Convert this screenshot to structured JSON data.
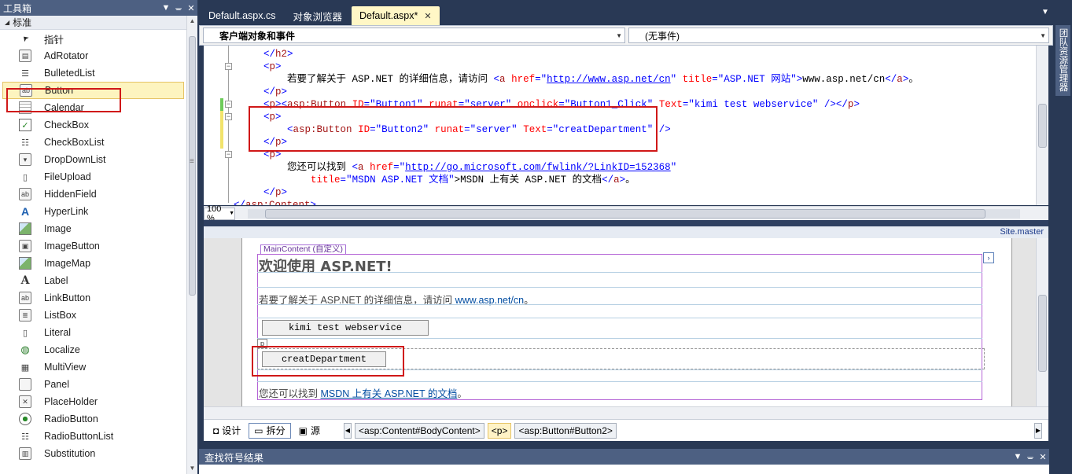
{
  "toolbox": {
    "title": "工具箱",
    "group": "标准",
    "items": [
      {
        "label": "指针",
        "icon": "pointer-icon"
      },
      {
        "label": "AdRotator",
        "icon": "adrotator-icon"
      },
      {
        "label": "BulletedList",
        "icon": "bulleted-list-icon"
      },
      {
        "label": "Button",
        "icon": "button-icon"
      },
      {
        "label": "Calendar",
        "icon": "calendar-icon"
      },
      {
        "label": "CheckBox",
        "icon": "checkbox-icon"
      },
      {
        "label": "CheckBoxList",
        "icon": "checkbox-list-icon"
      },
      {
        "label": "DropDownList",
        "icon": "dropdown-list-icon"
      },
      {
        "label": "FileUpload",
        "icon": "file-upload-icon"
      },
      {
        "label": "HiddenField",
        "icon": "hidden-field-icon"
      },
      {
        "label": "HyperLink",
        "icon": "hyperlink-icon"
      },
      {
        "label": "Image",
        "icon": "image-icon"
      },
      {
        "label": "ImageButton",
        "icon": "image-button-icon"
      },
      {
        "label": "ImageMap",
        "icon": "image-map-icon"
      },
      {
        "label": "Label",
        "icon": "label-icon"
      },
      {
        "label": "LinkButton",
        "icon": "link-button-icon"
      },
      {
        "label": "ListBox",
        "icon": "listbox-icon"
      },
      {
        "label": "Literal",
        "icon": "literal-icon"
      },
      {
        "label": "Localize",
        "icon": "localize-icon"
      },
      {
        "label": "MultiView",
        "icon": "multiview-icon"
      },
      {
        "label": "Panel",
        "icon": "panel-icon"
      },
      {
        "label": "PlaceHolder",
        "icon": "placeholder-icon"
      },
      {
        "label": "RadioButton",
        "icon": "radio-button-icon"
      },
      {
        "label": "RadioButtonList",
        "icon": "radio-button-list-icon"
      },
      {
        "label": "Substitution",
        "icon": "substitution-icon"
      }
    ],
    "selected": "Button"
  },
  "tabs": [
    {
      "label": "Default.aspx.cs",
      "active": false
    },
    {
      "label": "对象浏览器",
      "active": false
    },
    {
      "label": "Default.aspx*",
      "active": true
    }
  ],
  "nav": {
    "left_combo": "客户端对象和事件",
    "right_combo": "(无事件)"
  },
  "code": {
    "lines": [
      "        </h2>",
      "        <p>",
      "            若要了解关于 ASP.NET 的详细信息，请访问 <a href=\"http://www.asp.net/cn\" title=\"ASP.NET 网站\">www.asp.net/cn</a>。",
      "        </p>",
      "        <p><asp:Button ID=\"Button1\" runat=\"server\" onclick=\"Button1_Click\" Text=\"kimi test webservice\" /></p>",
      "        <p>",
      "            <asp:Button ID=\"Button2\" runat=\"server\" Text=\"creatDepartment\" />",
      "        </p>",
      "        <p>",
      "            您还可以找到 <a href=\"http://go.microsoft.com/fwlink/?LinkID=152368\"",
      "                title=\"MSDN ASP.NET 文档\">MSDN 上有关 ASP.NET 的文档</a>。",
      "        </p>",
      "</asp:Content>"
    ]
  },
  "zoom": "100 %",
  "design": {
    "master_label": "Site.master",
    "content_tag": "MainContent (自定义)",
    "heading": "欢迎使用 ASP.NET!",
    "para1_prefix": "若要了解关于 ASP.NET 的详细信息，请访问 ",
    "para1_link": "www.asp.net/cn",
    "para1_suffix": "。",
    "button1": "kimi test webservice",
    "p_tag": "p",
    "button2": "creatDepartment",
    "para2_prefix": "您还可以找到 ",
    "para2_link": "MSDN 上有关 ASP.NET 的文档",
    "para2_suffix": "。"
  },
  "view_bar": {
    "design": "设计",
    "split": "拆分",
    "source": "源",
    "crumbs": [
      "<asp:Content#BodyContent>",
      "<p>",
      "<asp:Button#Button2>"
    ]
  },
  "find_panel": {
    "title": "查找符号结果"
  },
  "right_tab": "团队资源管理器",
  "colors": {
    "highlight_box": "#d01818",
    "content_border": "#b463d6",
    "titlebar": "#4d6082"
  }
}
